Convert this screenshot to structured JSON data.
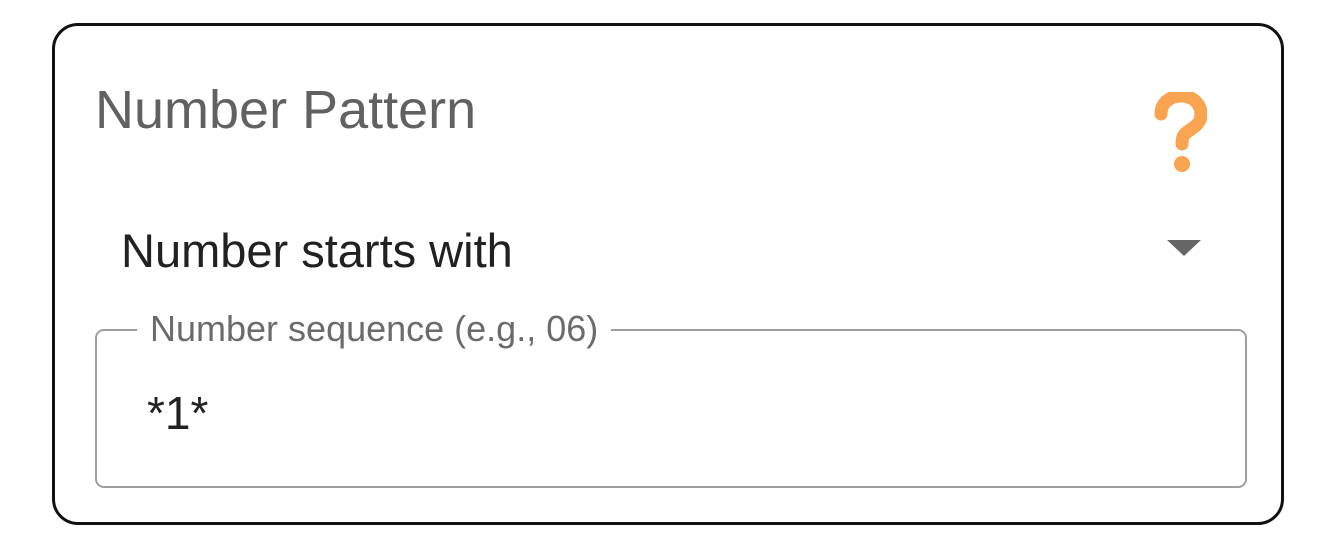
{
  "card": {
    "title": "Number Pattern"
  },
  "help": {
    "icon": "question-mark-icon",
    "color": "#f9a450"
  },
  "dropdown": {
    "selected": "Number starts with",
    "caret_icon": "caret-down-icon"
  },
  "sequence_field": {
    "label": "Number sequence (e.g., 06)",
    "value": "*1*"
  },
  "colors": {
    "border": "#111111",
    "title_text": "#616161",
    "body_text": "#212121",
    "field_border": "#9e9e9e",
    "accent": "#f9a450"
  }
}
